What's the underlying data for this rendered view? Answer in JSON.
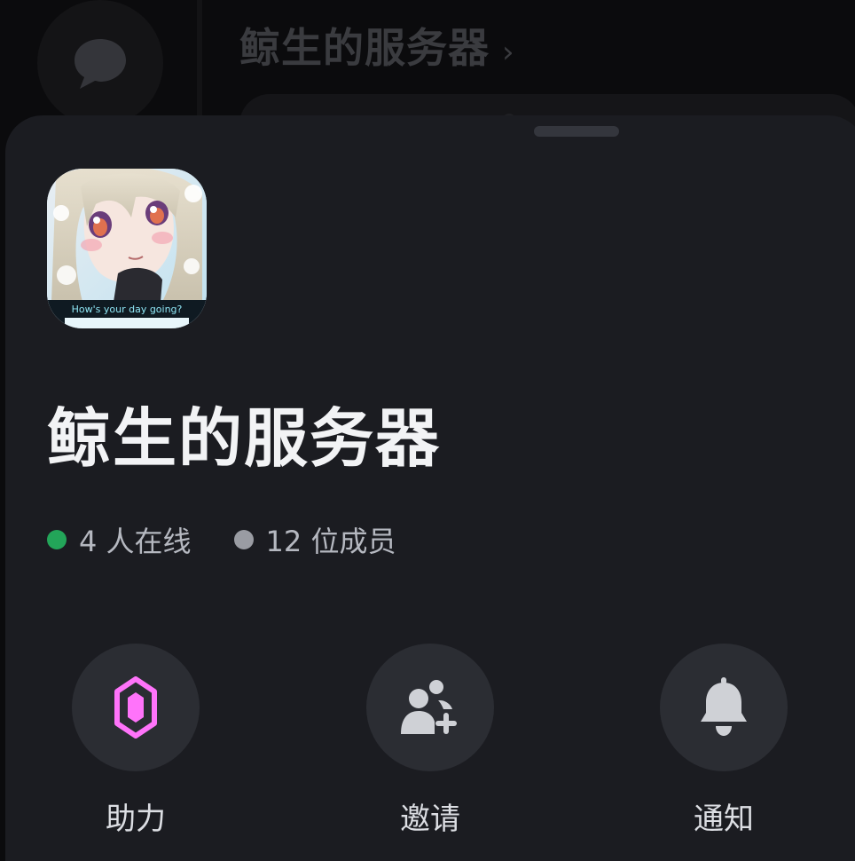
{
  "background": {
    "channel_title": "鲸生的服务器",
    "chevron_icon": "chevron-right-icon",
    "dm_icon": "chat-bubble-icon"
  },
  "sheet": {
    "server_name": "鲸生的服务器",
    "server_icon": "anime-avatar-image",
    "avatar_caption": "How's your day going?",
    "stats": {
      "online": "4 人在线",
      "members": "12 位成员"
    },
    "actions": [
      {
        "label": "助力",
        "icon": "boost-gem-icon"
      },
      {
        "label": "邀请",
        "icon": "add-friend-icon"
      },
      {
        "label": "通知",
        "icon": "bell-icon"
      }
    ]
  },
  "colors": {
    "sheet_bg": "#1b1c21",
    "online": "#23a559",
    "boost": "#ff73fa",
    "button_bg": "#2b2d33"
  }
}
